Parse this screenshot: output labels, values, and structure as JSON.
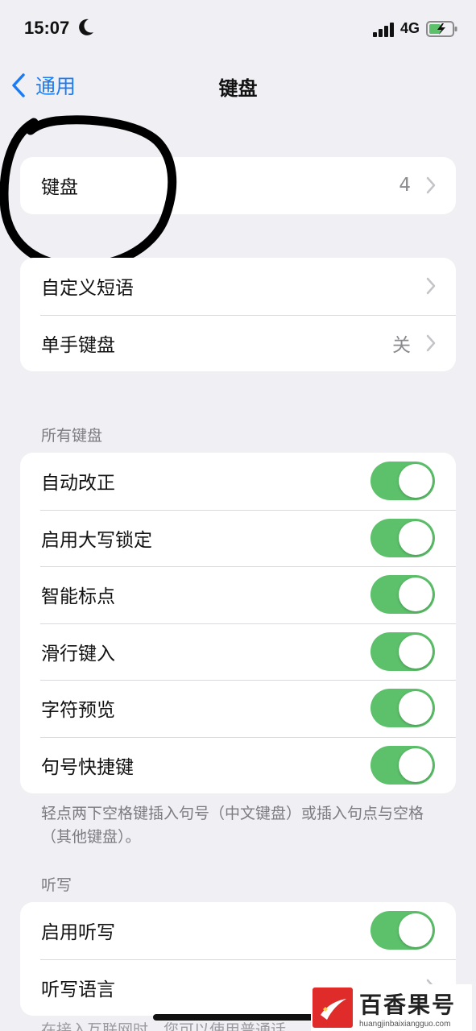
{
  "status_bar": {
    "time": "15:07",
    "network": "4G"
  },
  "nav": {
    "back_label": "通用",
    "title": "键盘"
  },
  "group_keyboards": {
    "label": "键盘",
    "value": "4"
  },
  "group_text": {
    "items": [
      {
        "label": "自定义短语",
        "value": ""
      },
      {
        "label": "单手键盘",
        "value": "关"
      }
    ]
  },
  "all_keyboards": {
    "header": "所有键盘",
    "toggles": [
      {
        "label": "自动改正",
        "on": true
      },
      {
        "label": "启用大写锁定",
        "on": true
      },
      {
        "label": "智能标点",
        "on": true
      },
      {
        "label": "滑行键入",
        "on": true
      },
      {
        "label": "字符预览",
        "on": true
      },
      {
        "label": "句号快捷键",
        "on": true
      }
    ],
    "footnote": "轻点两下空格键插入句号（中文键盘）或插入句点与空格（其他键盘）。"
  },
  "dictation": {
    "header": "听写",
    "enable_label": "启用听写",
    "enable_on": true,
    "language_label": "听写语言",
    "partial_footer": "在接入互联网时，您可以使用普通话"
  },
  "watermark": {
    "title": "百香果号",
    "url": "huangjinbaixiangguo.com"
  },
  "colors": {
    "accent": "#1a7cf5",
    "toggle_on": "#5cc16a",
    "background": "#efeff4",
    "annotation": "#000000"
  }
}
